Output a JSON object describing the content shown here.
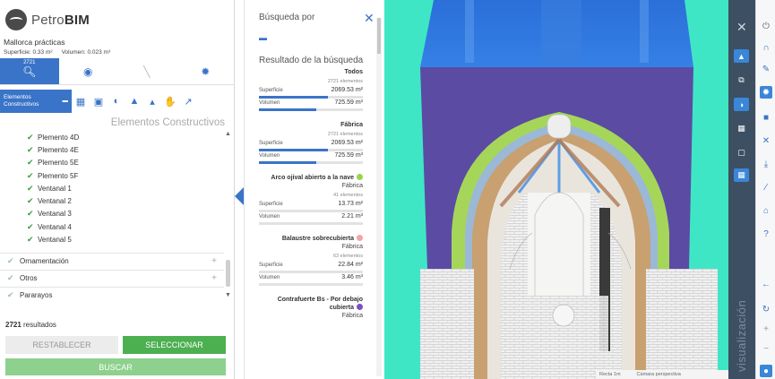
{
  "app": {
    "brand_light": "Petro",
    "brand_bold": "BIM",
    "project": "Mallorca prácticas",
    "surface_metric": "Superficie: 0.33 m²",
    "volume_metric": "Volumen: 0.023 m³"
  },
  "colors": {
    "accent": "#3a74c8",
    "green": "#4caf50",
    "toolbar_dark": "#3d4f63",
    "wall_purple": "#5b4ba3",
    "sky_blue": "#2f7de0",
    "floor_teal": "#3fe6c6"
  },
  "tabs_top": [
    {
      "icon": "search-icon",
      "count": "2721"
    },
    {
      "icon": "eye-icon"
    },
    {
      "icon": "slash-icon"
    },
    {
      "icon": "magic-wand-icon"
    }
  ],
  "category": {
    "active_label": "Elementos Constructivos",
    "section_title": "Elementos Constructivos"
  },
  "tree_items": [
    "Plemento 4D",
    "Plemento 4E",
    "Plemento 5E",
    "Plemento 5F",
    "Ventanal 1",
    "Ventanal 2",
    "Ventanal 3",
    "Ventanal 4",
    "Ventanal 5"
  ],
  "groups": [
    "Ornamentación",
    "Otros",
    "Pararayos"
  ],
  "footer": {
    "results_count": "2721",
    "results_suffix": " resultados",
    "reset": "RESTABLECER",
    "select": "SELECCIONAR",
    "search": "BUSCAR"
  },
  "search_panel": {
    "title": "Búsqueda por",
    "results_title": "Resultado de la búsqueda",
    "surface_label": "Superficie",
    "volume_label": "Volumen",
    "blocks": [
      {
        "title": "Todos",
        "subtitle": "",
        "dot": "",
        "count": "2721 elementos",
        "surface": "2069.53 m²",
        "surface_fill": 0.66,
        "volume": "725.59 m³",
        "volume_fill": 0.55
      },
      {
        "title": "Fábrica",
        "subtitle": "",
        "dot": "",
        "count": "2721 elementos",
        "surface": "2069.53 m²",
        "surface_fill": 0.66,
        "volume": "725.59 m³",
        "volume_fill": 0.55
      },
      {
        "title": "Arco ojival abierto a la nave",
        "subtitle": "Fábrica",
        "dot": "#9bd24a",
        "count": "41 elementos",
        "surface": "13.73 m²",
        "surface_fill": 0.0,
        "volume": "2.21 m³",
        "volume_fill": 0.0
      },
      {
        "title": "Balaustre sobrecubierta",
        "subtitle": "Fábrica",
        "dot": "#f2a5a5",
        "count": "63 elementos",
        "surface": "22.84 m²",
        "surface_fill": 0.0,
        "volume": "3.46 m³",
        "volume_fill": 0.0
      },
      {
        "title": "Contrafuerte Bs - Por debajo cubierta",
        "subtitle": "Fábrica",
        "dot": "#7a4fc2",
        "count": "",
        "surface": "",
        "surface_fill": 0,
        "volume": "",
        "volume_fill": 0
      }
    ]
  },
  "viewport": {
    "scale": "Recta 1m",
    "camera": "Cámara perspectiva",
    "toolbar_label": "visualización"
  }
}
